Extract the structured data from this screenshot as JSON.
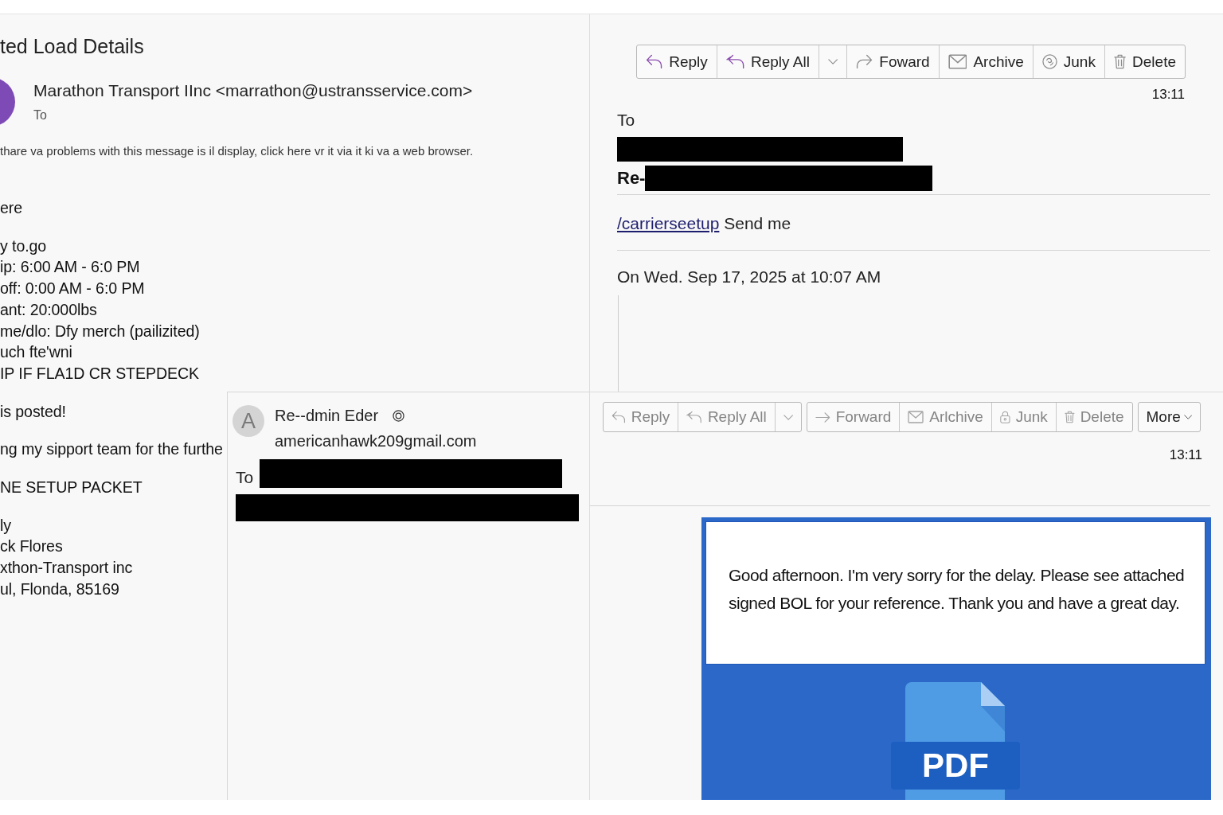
{
  "left_message": {
    "subject": "ted Load Details",
    "sender": "Marathon Transport IInc <marrathon@ustransservice.com>",
    "to_label": "To",
    "notice": "thare va problems with this message is il display, click here vr it via it ki va a web browser.",
    "paragraphs": [
      [
        "ere"
      ],
      [
        "y to.go",
        "ip: 6:00 AM - 6:0 PM",
        "off: 0:00 AM - 6:0 PM",
        "ant: 20:000lbs",
        "me/dlo: Dfy merch (pailizited)",
        "uch fte'wni",
        "IP IF FLA1D CR STEPDECK"
      ],
      [
        "is posted!"
      ],
      [
        "ng my sipport team for the furthe"
      ],
      [
        "NE SETUP PACKET"
      ],
      [
        "ly",
        "ck Flores",
        "xthon-Transport inc",
        "ul, Flonda, 85169"
      ]
    ]
  },
  "reply_card": {
    "initial": "A",
    "sender": "Re--dmin Eder",
    "email": "americanhawk209gmail.com",
    "recipients": [
      {
        "label": "To",
        "redacted": true
      },
      {
        "redacted": true
      }
    ]
  },
  "top_message": {
    "toolbar": [
      [
        {
          "kind": "reply",
          "label": "Reply",
          "disabled": false
        },
        {
          "kind": "replyall",
          "label": "Reply All",
          "disabled": false
        },
        {
          "kind": "menu",
          "disabled": false
        },
        {
          "kind": "forward",
          "label": "Foward",
          "disabled": false
        },
        {
          "kind": "archive",
          "label": "Archive",
          "disabled": false
        },
        {
          "kind": "junk",
          "label": "Junk",
          "disabled": false
        },
        {
          "kind": "delete",
          "label": "Delete",
          "disabled": false
        }
      ]
    ],
    "time": "13:11",
    "to_label": "To",
    "to_redacted": true,
    "subject_prefix": "Re-",
    "subject_redacted": true,
    "body": {
      "link": "/carrierseetup",
      "text": "Send me"
    },
    "quote_header": "On Wed. Sep 17, 2025 at 10:07 AM"
  },
  "bottom_message": {
    "toolbar": [
      [
        {
          "kind": "reply",
          "label": "Reply",
          "disabled": true
        },
        {
          "kind": "replyall",
          "label": "Reply All",
          "disabled": true
        },
        {
          "kind": "menu",
          "disabled": true
        }
      ],
      [
        {
          "kind": "forward",
          "label": "Forward",
          "disabled": true
        },
        {
          "kind": "archive",
          "label": "Arlchive",
          "disabled": true
        },
        {
          "kind": "lock",
          "label": "Junk",
          "disabled": true
        },
        {
          "kind": "delete",
          "label": "Delete",
          "disabled": true
        }
      ],
      [
        {
          "kind": "more",
          "label": "More",
          "disabled": false
        }
      ]
    ],
    "time": "13:11",
    "message": "Good afternoon. I'm very sorry for the delay. Please see attached signed BOL for your reference. Thank you and have a great day.",
    "attachment": {
      "kind": "pdf",
      "label": "PDF"
    }
  }
}
